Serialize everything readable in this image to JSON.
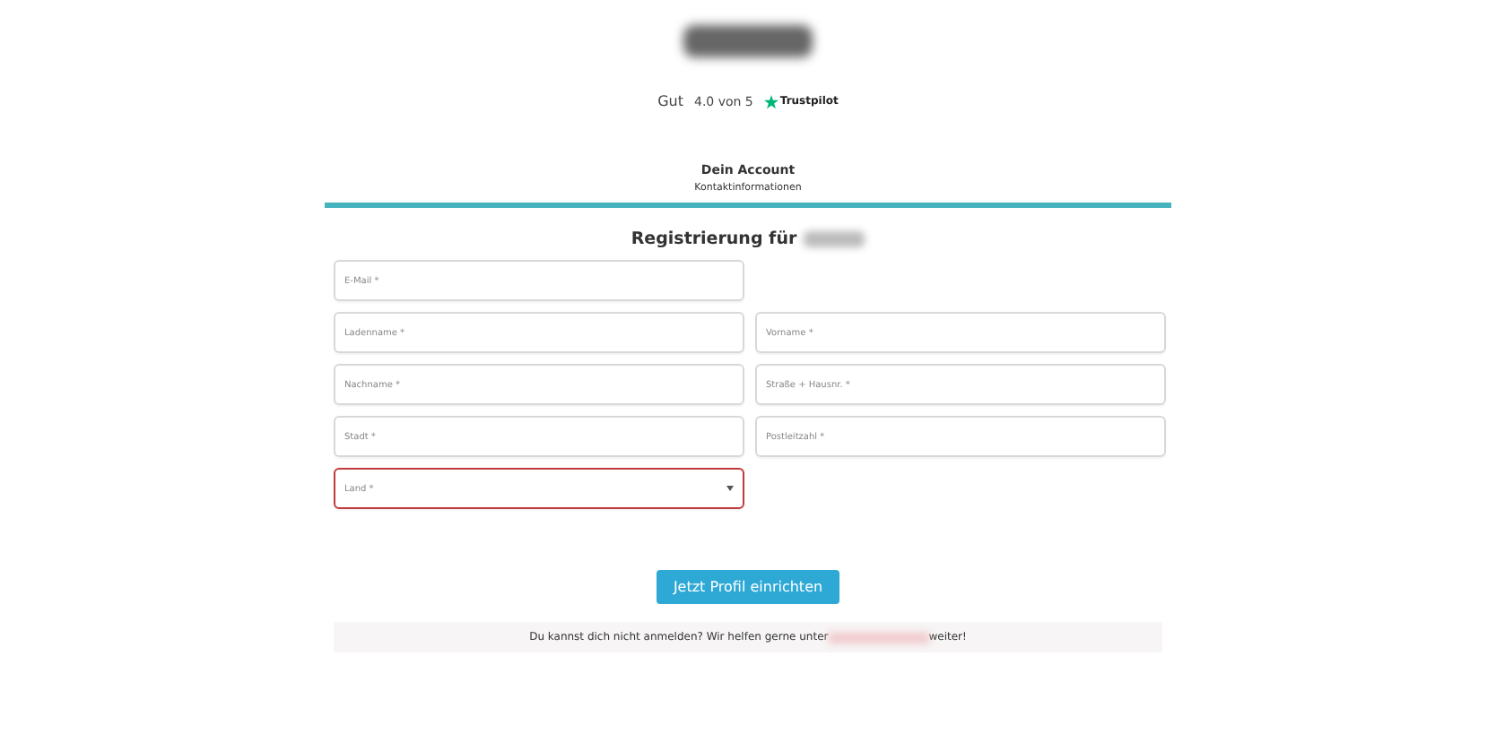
{
  "rating": {
    "label": "Gut",
    "score": "4.0 von 5",
    "brand": "Trustpilot"
  },
  "step": {
    "title": "Dein Account",
    "subtitle": "Kontaktinformationen",
    "level": 1
  },
  "form": {
    "title": "Registrierung für",
    "rows": [
      [
        {
          "placeholder": "E-Mail *",
          "kind": "text",
          "invalid": false
        }
      ],
      [
        {
          "placeholder": "Ladenname *",
          "kind": "text",
          "invalid": false
        },
        {
          "placeholder": "Vorname *",
          "kind": "text",
          "invalid": false
        }
      ],
      [
        {
          "placeholder": "Nachname *",
          "kind": "text",
          "invalid": false
        },
        {
          "placeholder": "Straße + Hausnr. *",
          "kind": "text",
          "invalid": false
        }
      ],
      [
        {
          "placeholder": "Stadt *",
          "kind": "text",
          "invalid": false
        },
        {
          "placeholder": "Postleitzahl *",
          "kind": "text",
          "invalid": false
        }
      ],
      [
        {
          "placeholder": "Land *",
          "kind": "select",
          "invalid": true
        }
      ]
    ],
    "submit": "Jetzt Profil einrichten"
  },
  "help": {
    "before": "Du kannst dich nicht anmelden? Wir helfen gerne unter",
    "after": "weiter!"
  }
}
